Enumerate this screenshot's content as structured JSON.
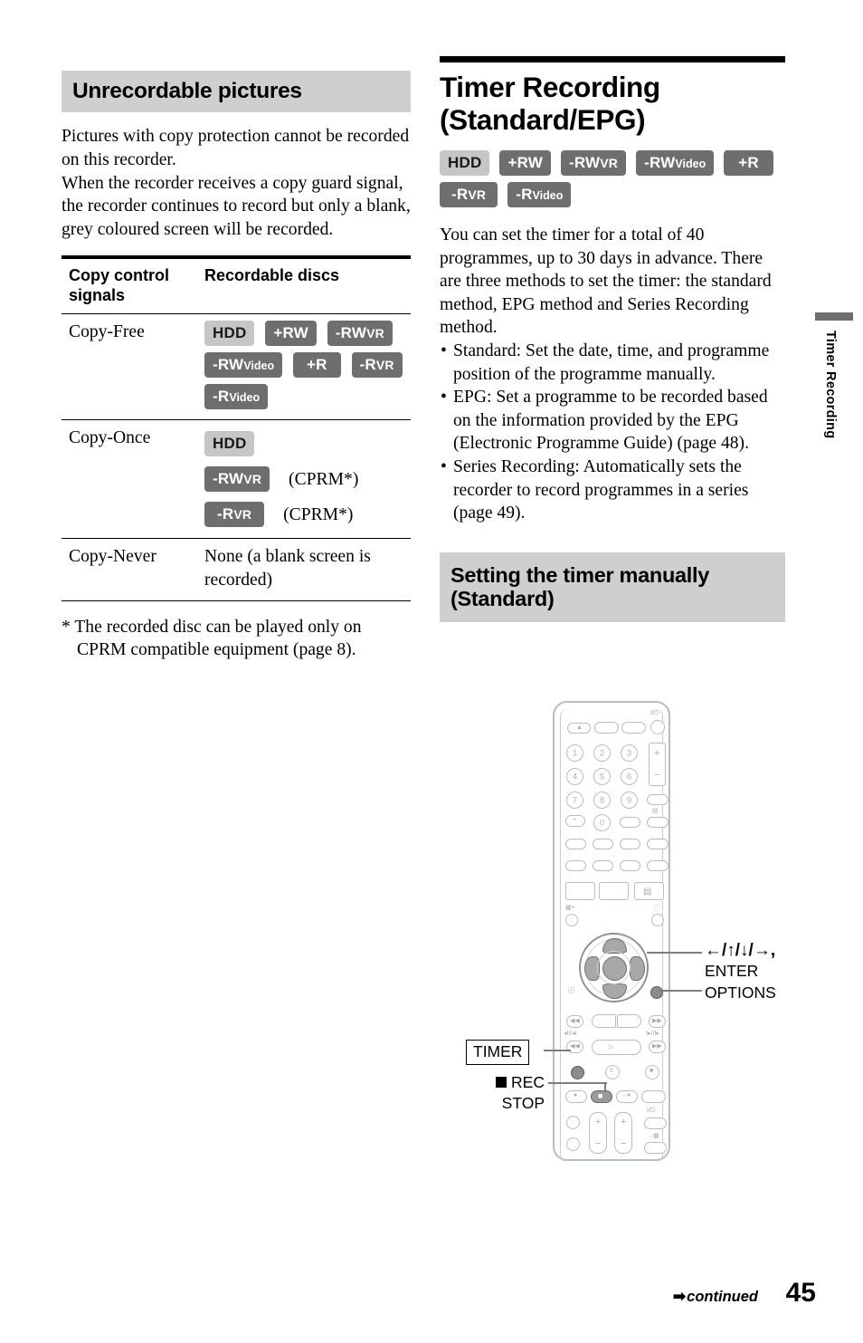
{
  "page": {
    "number": "45",
    "continued_label": "continued",
    "continued_arrow": "➡",
    "side_tab_label": "Timer Recording"
  },
  "left_column": {
    "heading": "Unrecordable pictures",
    "paragraphs": [
      "Pictures with copy protection cannot be recorded on this recorder.",
      "When the recorder receives a copy guard signal, the recorder continues to record but only a blank, grey coloured screen will be recorded."
    ],
    "table": {
      "headers": [
        "Copy control signals",
        "Recordable discs"
      ],
      "rows": [
        {
          "signal": "Copy-Free",
          "type": "badges",
          "badge_rows": [
            [
              {
                "label": "HDD",
                "style": "hdd"
              },
              {
                "label": "+RW",
                "style": "dark"
              },
              {
                "label": "-RW",
                "sub": "VR",
                "sub_size": "mid",
                "style": "dark"
              }
            ],
            [
              {
                "label": "-RW",
                "sub": "Video",
                "sub_size": "sm",
                "style": "dark"
              },
              {
                "label": "+R",
                "style": "dark"
              },
              {
                "label": "-R",
                "sub": "VR",
                "sub_size": "mid",
                "style": "dark"
              }
            ],
            [
              {
                "label": "-R",
                "sub": "Video",
                "sub_size": "sm",
                "style": "dark"
              }
            ]
          ]
        },
        {
          "signal": "Copy-Once",
          "type": "badges_notes",
          "badge_rows": [
            {
              "badges": [
                {
                  "label": "HDD",
                  "style": "hdd"
                }
              ],
              "note": ""
            },
            {
              "badges": [
                {
                  "label": "-RW",
                  "sub": "VR",
                  "sub_size": "mid",
                  "style": "dark"
                }
              ],
              "note": "(CPRM*)"
            },
            {
              "badges": [
                {
                  "label": "-R",
                  "sub": "VR",
                  "sub_size": "mid",
                  "style": "dark"
                }
              ],
              "note": "(CPRM*)"
            }
          ]
        },
        {
          "signal": "Copy-Never",
          "type": "text",
          "text": "None (a blank screen is recorded)"
        }
      ]
    },
    "footnote": "* The recorded disc can be played only on CPRM compatible equipment (page 8)."
  },
  "right_column": {
    "title": "Timer Recording (Standard/EPG)",
    "disc_badges": [
      [
        {
          "label": "HDD",
          "style": "hdd"
        },
        {
          "label": "+RW",
          "style": "dark"
        },
        {
          "label": "-RW",
          "sub": "VR",
          "sub_size": "mid",
          "style": "dark"
        },
        {
          "label": "-RW",
          "sub": "Video",
          "sub_size": "sm",
          "style": "dark"
        },
        {
          "label": "+R",
          "style": "dark"
        }
      ],
      [
        {
          "label": "-R",
          "sub": "VR",
          "sub_size": "mid",
          "style": "dark"
        },
        {
          "label": "-R",
          "sub": "Video",
          "sub_size": "sm",
          "style": "dark"
        }
      ]
    ],
    "intro": "You can set the timer for a total of 40 programmes, up to 30 days in advance. There are three methods to set the timer: the standard method, EPG method and Series Recording method.",
    "bullets": [
      "Standard: Set the date, time, and programme position of the programme manually.",
      "EPG: Set a programme to be recorded based on the information provided by the EPG (Electronic Programme Guide) (page 48).",
      "Series Recording: Automatically sets the recorder to record programmes in a series (page 49)."
    ],
    "subheading": "Setting the timer manually (Standard)"
  },
  "remote_callouts": {
    "arrows": "←/↑/↓/→,",
    "enter": "ENTER",
    "options": "OPTIONS",
    "timer": "TIMER",
    "rec": "REC",
    "stop": "STOP"
  },
  "remote_keys": {
    "numbers": [
      "1",
      "2",
      "3",
      "4",
      "5",
      "6",
      "7",
      "8",
      "9",
      "0"
    ],
    "power_glyph": "I/⏻",
    "volume_plus": "+",
    "volume_minus": "−"
  },
  "colors": {
    "heading_bg": "#cfcfcf",
    "badge_dark": "#6e6e6e",
    "badge_light": "#c6c6c6",
    "side_tab": "#6e6e6e",
    "rule": "#000000"
  }
}
